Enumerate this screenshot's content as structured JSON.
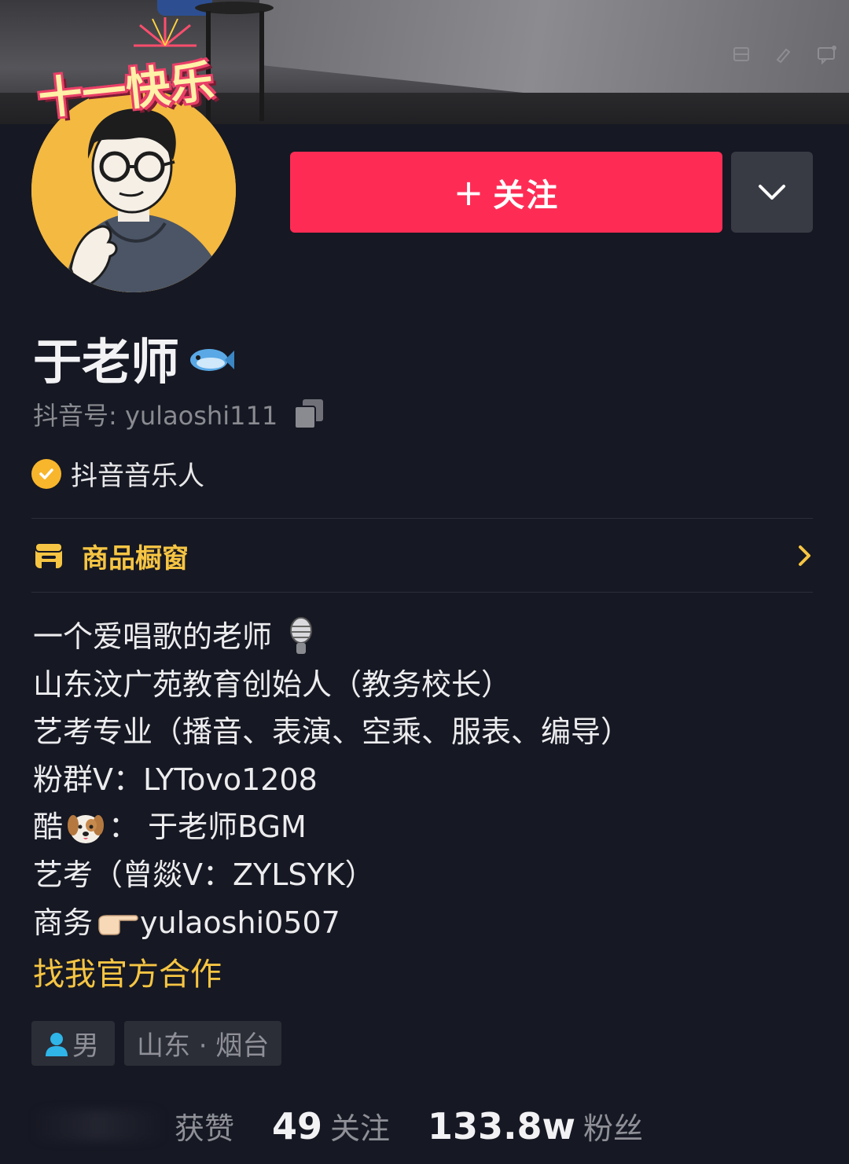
{
  "cover": {
    "badge_text": "十一快乐",
    "icons": [
      "tv-icon",
      "edit-icon",
      "message-icon"
    ]
  },
  "buttons": {
    "follow_plus": "+",
    "follow_label": "关注",
    "more_icon": "chevron-down-icon"
  },
  "profile": {
    "name": "于老师",
    "name_emoji": "fish",
    "douyin_id_label": "抖音号: yulaoshi111",
    "verify_label": "抖音音乐人"
  },
  "shop": {
    "label": "商品橱窗",
    "icon": "storefront-icon"
  },
  "bio": {
    "line1": "一个爱唱歌的老师",
    "line2": "山东汶广苑教育创始人（教务校长）",
    "line3": "艺考专业（播音、表演、空乘、服表、编导）",
    "line4": "粉群V：LYTovo1208",
    "line5_prefix": "酷",
    "line5_suffix": "： 于老师BGM",
    "line6": "艺考（曾燚V：ZYLSYK）",
    "line7_prefix": "商务",
    "line7_suffix": "yulaoshi0507",
    "official_link": "找我官方合作"
  },
  "tags": {
    "gender": "男",
    "location": "山东 · 烟台"
  },
  "stats": {
    "likes_label": "获赞",
    "following_count": "49",
    "following_label": "关注",
    "followers_count": "133.8w",
    "followers_label": "粉丝"
  },
  "colors": {
    "background": "#161823",
    "follow_button": "#fe2c55",
    "accent_yellow": "#f6c543"
  }
}
